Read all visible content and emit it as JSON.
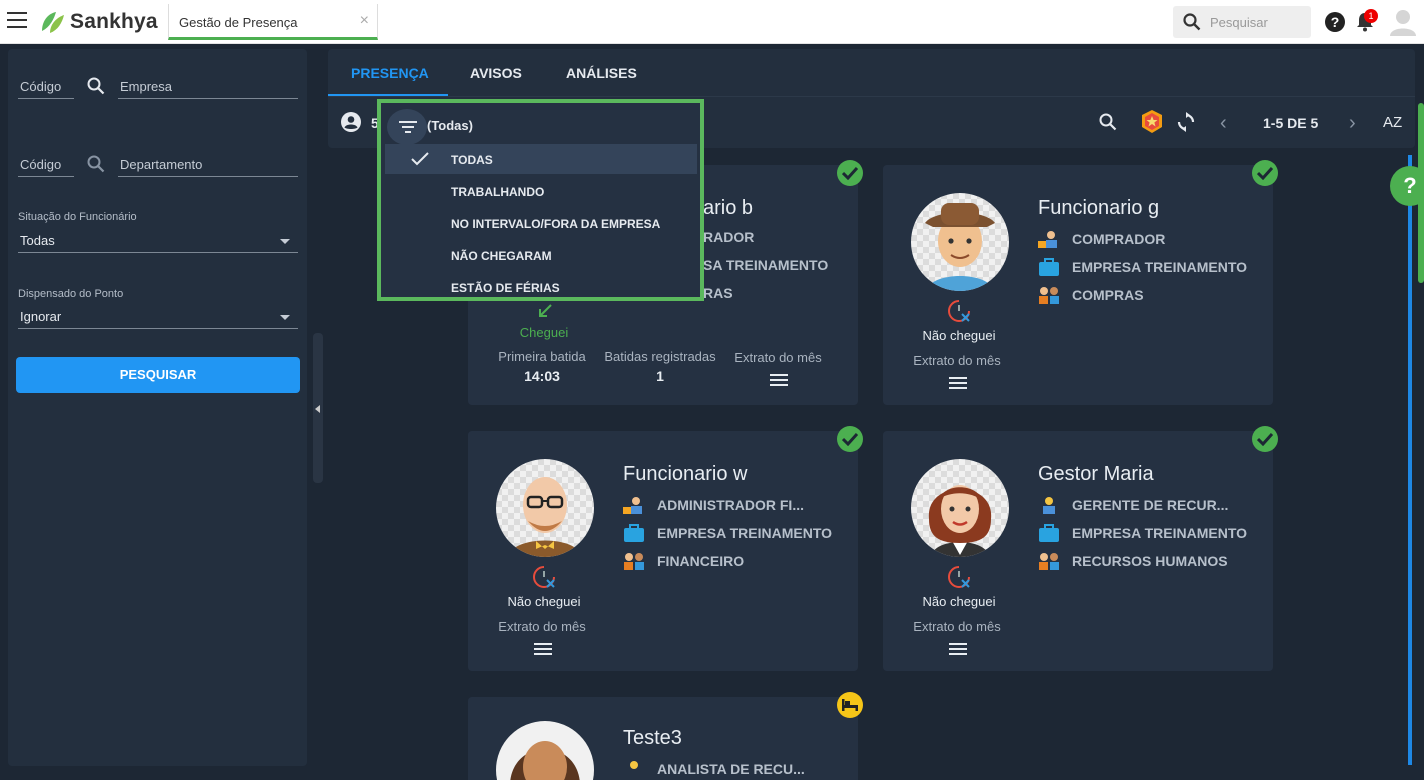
{
  "topbar": {
    "brand": "Sankhya",
    "app_tab": "Gestão de Presença",
    "close": "×",
    "search_placeholder": "Pesquisar",
    "notification_count": "1",
    "help": "?"
  },
  "sidebar": {
    "empresa_code": "Código",
    "empresa_label": "Empresa",
    "depto_code": "Código",
    "depto_label": "Departamento",
    "situacao_label": "Situação do Funcionário",
    "situacao_value": "Todas",
    "dispensado_label": "Dispensado do Ponto",
    "dispensado_value": "Ignorar",
    "search_button": "PESQUISAR"
  },
  "tabs": [
    {
      "label": "PRESENÇA",
      "active": true
    },
    {
      "label": "AVISOS",
      "active": false
    },
    {
      "label": "ANÁLISES",
      "active": false
    }
  ],
  "toolbar": {
    "count_partial": "5",
    "pagination": "1-5 DE 5",
    "sort_label": "AZ"
  },
  "filter_dropdown": {
    "current": "(Todas)",
    "options": [
      "TODAS",
      "TRABALHANDO",
      "NO INTERVALO/FORA DA EMPRESA",
      "NÃO CHEGARAM",
      "ESTÃO DE FÉRIAS"
    ],
    "selected_index": 0
  },
  "cards": [
    {
      "name_partial": "ario b",
      "role_partial": "RADOR",
      "company_partial": "SA TREINAMENTO",
      "dept_partial": "RAS",
      "status": "Cheguei",
      "primeira_batida_label": "Primeira batida",
      "primeira_batida_value": "14:03",
      "batidas_label": "Batidas registradas",
      "batidas_value": "1",
      "extrato_label": "Extrato do mês"
    },
    {
      "name": "Funcionario g",
      "role": "COMPRADOR",
      "company": "EMPRESA TREINAMENTO",
      "dept": "COMPRAS",
      "status": "Não cheguei",
      "extrato_label": "Extrato do mês"
    },
    {
      "name": "Funcionario w",
      "role": "ADMINISTRADOR FI...",
      "company": "EMPRESA TREINAMENTO",
      "dept": "FINANCEIRO",
      "status": "Não cheguei",
      "extrato_label": "Extrato do mês"
    },
    {
      "name": "Gestor Maria",
      "role": "GERENTE DE RECUR...",
      "company": "EMPRESA TREINAMENTO",
      "dept": "RECURSOS HUMANOS",
      "status": "Não cheguei",
      "extrato_label": "Extrato do mês"
    },
    {
      "name": "Teste3",
      "role": "ANALISTA DE RECU..."
    }
  ],
  "colors": {
    "accent": "#2196f3",
    "success": "#4caf50",
    "highlight_border": "#5bb85d",
    "background": "#1d2734",
    "card": "#253142"
  }
}
